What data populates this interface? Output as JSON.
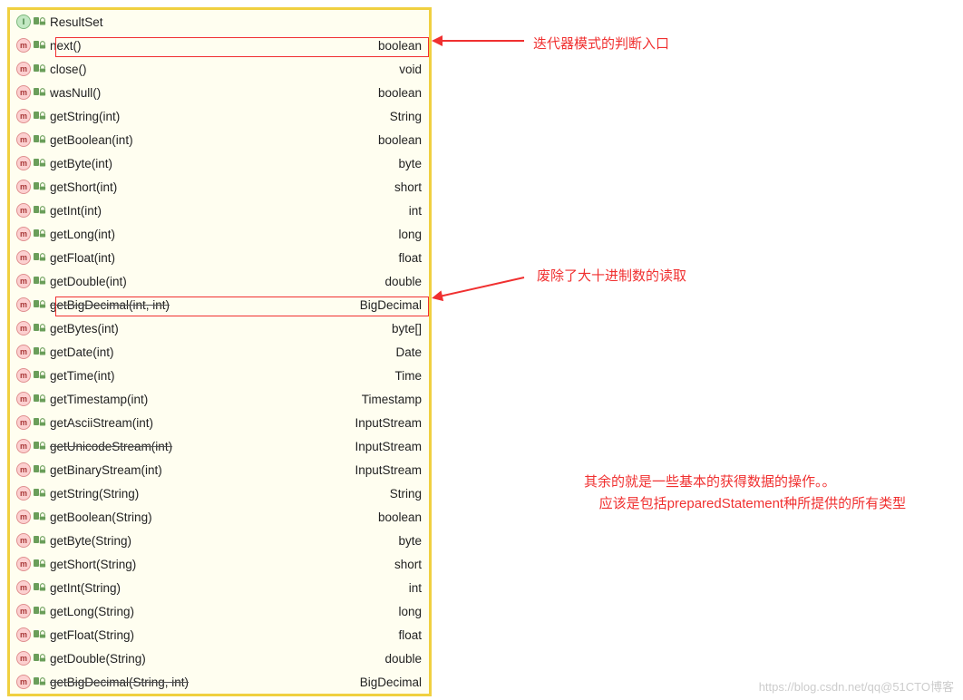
{
  "header": {
    "name": "ResultSet"
  },
  "methods": [
    {
      "name": "next()",
      "ret": "boolean",
      "dep": false
    },
    {
      "name": "close()",
      "ret": "void",
      "dep": false
    },
    {
      "name": "wasNull()",
      "ret": "boolean",
      "dep": false
    },
    {
      "name": "getString(int)",
      "ret": "String",
      "dep": false
    },
    {
      "name": "getBoolean(int)",
      "ret": "boolean",
      "dep": false
    },
    {
      "name": "getByte(int)",
      "ret": "byte",
      "dep": false
    },
    {
      "name": "getShort(int)",
      "ret": "short",
      "dep": false
    },
    {
      "name": "getInt(int)",
      "ret": "int",
      "dep": false
    },
    {
      "name": "getLong(int)",
      "ret": "long",
      "dep": false
    },
    {
      "name": "getFloat(int)",
      "ret": "float",
      "dep": false
    },
    {
      "name": "getDouble(int)",
      "ret": "double",
      "dep": false
    },
    {
      "name": "getBigDecimal(int, int)",
      "ret": "BigDecimal",
      "dep": true
    },
    {
      "name": "getBytes(int)",
      "ret": "byte[]",
      "dep": false
    },
    {
      "name": "getDate(int)",
      "ret": "Date",
      "dep": false
    },
    {
      "name": "getTime(int)",
      "ret": "Time",
      "dep": false
    },
    {
      "name": "getTimestamp(int)",
      "ret": "Timestamp",
      "dep": false
    },
    {
      "name": "getAsciiStream(int)",
      "ret": "InputStream",
      "dep": false
    },
    {
      "name": "getUnicodeStream(int)",
      "ret": "InputStream",
      "dep": true
    },
    {
      "name": "getBinaryStream(int)",
      "ret": "InputStream",
      "dep": false
    },
    {
      "name": "getString(String)",
      "ret": "String",
      "dep": false
    },
    {
      "name": "getBoolean(String)",
      "ret": "boolean",
      "dep": false
    },
    {
      "name": "getByte(String)",
      "ret": "byte",
      "dep": false
    },
    {
      "name": "getShort(String)",
      "ret": "short",
      "dep": false
    },
    {
      "name": "getInt(String)",
      "ret": "int",
      "dep": false
    },
    {
      "name": "getLong(String)",
      "ret": "long",
      "dep": false
    },
    {
      "name": "getFloat(String)",
      "ret": "float",
      "dep": false
    },
    {
      "name": "getDouble(String)",
      "ret": "double",
      "dep": false
    },
    {
      "name": "getBigDecimal(String, int)",
      "ret": "BigDecimal",
      "dep": true
    }
  ],
  "annotations": {
    "a1": "迭代器模式的判断入口",
    "a2": "废除了大十进制数的读取",
    "a3_l1": "其余的就是一些基本的获得数据的操作。。",
    "a3_l2": "    应该是包括preparedStatement种所提供的所有类型"
  },
  "watermark": "https://blog.csdn.net/qq@51CTO博客"
}
